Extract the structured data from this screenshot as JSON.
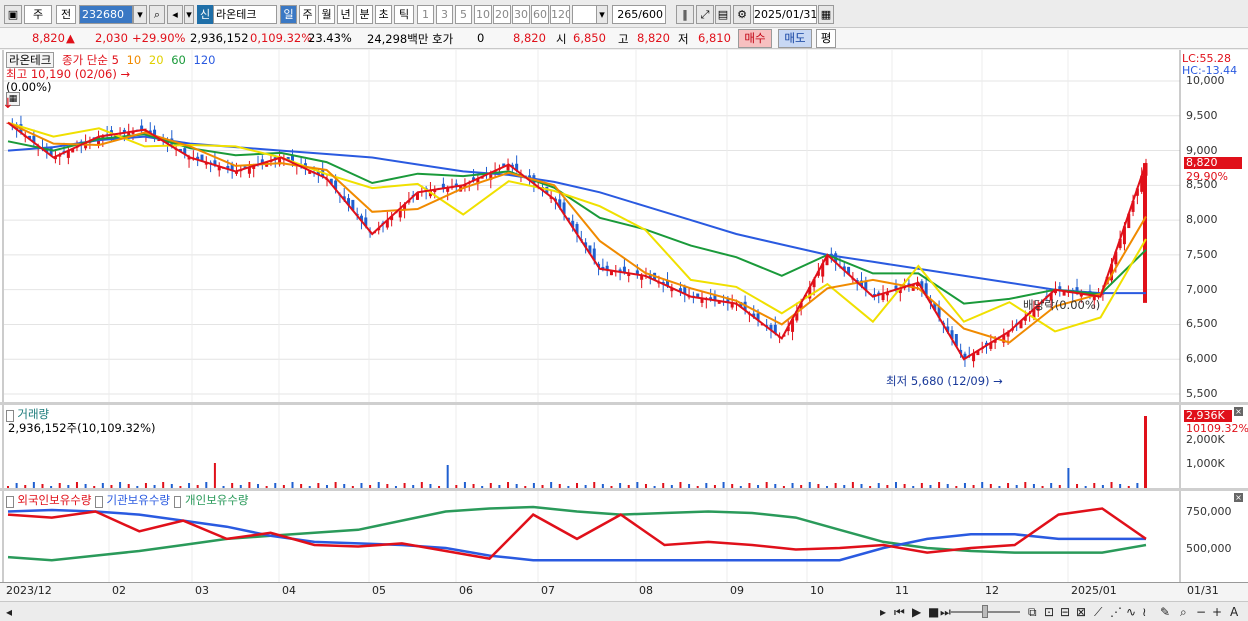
{
  "toolbar": {
    "period": "주",
    "compare": "전",
    "code": "232680",
    "market_badge": "신",
    "stock_name": "라온테크",
    "periods": [
      "일",
      "주",
      "월",
      "년",
      "분",
      "초",
      "틱"
    ],
    "intervals": [
      "1",
      "3",
      "5",
      "10",
      "20",
      "30",
      "60",
      "120"
    ],
    "count": "265",
    "count_total": "/600",
    "date": "2025/01/31"
  },
  "quote": {
    "price": "8,820",
    "change": "2,030",
    "change_pct": "+29.90%",
    "volume": "2,936,152",
    "volume_pct": "0,109.32%",
    "turnover": "23.43%",
    "amount": "24,298백만",
    "bid_label": "호가",
    "bid_value": "0",
    "ask_price": "8,820",
    "open_label": "시",
    "open": "6,850",
    "high_label": "고",
    "high": "8,820",
    "low_label": "저",
    "low": "6,810",
    "buy": "매수",
    "sell": "매도",
    "eval": "평"
  },
  "price_panel": {
    "name": "라온테크",
    "ma_label": "종가 단순",
    "ma_periods": [
      "5",
      "10",
      "20",
      "60",
      "120"
    ],
    "high_note": "최고 10,190 (02/06)",
    "pct_note": "(0.00%)",
    "low_note": "최저 5,680 (12/09)",
    "div_note": "배당락(0.00%)",
    "lc": "LC:55.28",
    "hc": "HC:-13.44",
    "y_ticks": [
      "10,000",
      "9,500",
      "9,000",
      "8,500",
      "8,000",
      "7,500",
      "7,000",
      "6,500",
      "6,000",
      "5,500"
    ],
    "last_price_tag": "8,820",
    "last_pct_tag": "29.90%"
  },
  "volume_panel": {
    "title": "거래량",
    "note": "2,936,152주(10,109.32%)",
    "y_ticks": [
      "2,000K",
      "1,000K"
    ],
    "last_tag": "2,936K",
    "last_pct": "10109.32%"
  },
  "holding_panel": {
    "series": [
      "외국인보유수량",
      "기관보유수량",
      "개인보유수량"
    ],
    "y_ticks": [
      "750,000",
      "500,000"
    ]
  },
  "x_labels": [
    "2023/12",
    "02",
    "03",
    "04",
    "05",
    "06",
    "07",
    "08",
    "09",
    "10",
    "11",
    "12",
    "2025/01",
    "01/31"
  ],
  "colors": {
    "ma5": "#e0101a",
    "ma10": "#f08a00",
    "ma20": "#f0e000",
    "ma60": "#1a9a3a",
    "ma120": "#2a5ae0",
    "up": "#e0101a",
    "down": "#1f5fd0",
    "foreign": "#e0101a",
    "inst": "#2a5ae0",
    "indiv": "#2a9a5a"
  },
  "chart_data": {
    "type": "line",
    "title": "",
    "price_series_ma": [
      {
        "name": "5",
        "values_sampled": [
          9400,
          8900,
          9200,
          9300,
          8900,
          8700,
          8900,
          8600,
          7800,
          8400,
          8500,
          8800,
          8300,
          7300,
          7200,
          6900,
          6800,
          6300,
          7500,
          6900,
          7100,
          6000,
          6400,
          7000,
          6900,
          8820
        ]
      },
      {
        "name": "120",
        "values_sampled": [
          9000,
          9050,
          9150,
          9200,
          9100,
          9050,
          9000,
          8950,
          8900,
          8800,
          8700,
          8650,
          8550,
          8400,
          8200,
          8000,
          7800,
          7650,
          7500,
          7400,
          7300,
          7200,
          7100,
          7000,
          6950,
          6950
        ]
      }
    ],
    "ylim": [
      5500,
      10300
    ]
  }
}
